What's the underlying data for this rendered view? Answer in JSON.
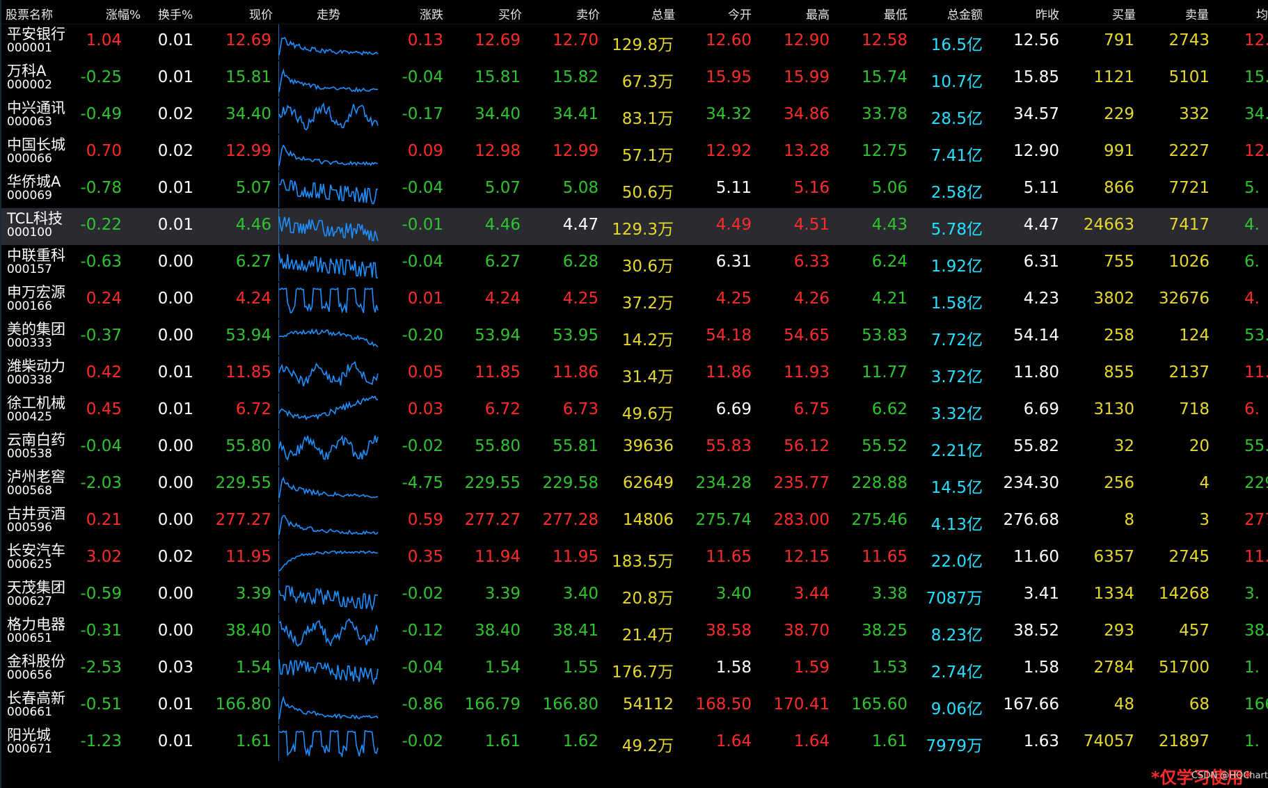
{
  "colors": {
    "up": "#ff2b2b",
    "down": "#2fc42f",
    "flat": "#ffffff",
    "volume": "#e6d82a",
    "amount": "#25e0ff",
    "quantity": "#e6d82a",
    "trend_line": "#1e90ff",
    "selected_row_bg": "#2a2b30"
  },
  "header": {
    "name": "股票名称",
    "change_pct": "涨幅%",
    "turnover": "换手%",
    "price": "现价",
    "trend": "走势",
    "change": "涨跌",
    "bid": "买价",
    "ask": "卖价",
    "volume": "总量",
    "open": "今开",
    "high": "最高",
    "low": "最低",
    "amount": "总金额",
    "prev_close": "昨收",
    "bid_qty": "买量",
    "ask_qty": "卖量",
    "extra_col": "均",
    "extra_value_label": ""
  },
  "rows": [
    {
      "name": "平安银行",
      "code": "000001",
      "change_pct": "1.04",
      "turnover": "0.01",
      "price": "12.69",
      "change": "0.13",
      "bid": "12.69",
      "ask": "12.70",
      "volume": "129.8万",
      "open": "12.60",
      "high": "12.90",
      "low": "12.58",
      "amount": "16.5亿",
      "prev_close": "12.56",
      "bid_qty": "791",
      "ask_qty": "2743",
      "extra": "12.",
      "dir": "up",
      "open_dir": "up",
      "high_dir": "up",
      "low_dir": "up",
      "extra_dir": "up",
      "trend_style": "spike_decay"
    },
    {
      "name": "万科A",
      "code": "000002",
      "change_pct": "-0.25",
      "turnover": "0.01",
      "price": "15.81",
      "change": "-0.04",
      "bid": "15.81",
      "ask": "15.82",
      "volume": "67.3万",
      "open": "15.95",
      "high": "15.99",
      "low": "15.74",
      "amount": "10.7亿",
      "prev_close": "15.85",
      "bid_qty": "1121",
      "ask_qty": "5101",
      "extra": "15.",
      "dir": "down",
      "open_dir": "up",
      "high_dir": "up",
      "low_dir": "down",
      "extra_dir": "down",
      "trend_style": "spike_decay"
    },
    {
      "name": "中兴通讯",
      "code": "000063",
      "change_pct": "-0.49",
      "turnover": "0.02",
      "price": "34.40",
      "change": "-0.17",
      "bid": "34.40",
      "ask": "34.41",
      "volume": "83.1万",
      "open": "34.32",
      "high": "34.86",
      "low": "33.78",
      "amount": "28.5亿",
      "prev_close": "34.57",
      "bid_qty": "229",
      "ask_qty": "332",
      "extra": "34.",
      "dir": "down",
      "open_dir": "down",
      "high_dir": "up",
      "low_dir": "down",
      "extra_dir": "down",
      "trend_style": "wavy"
    },
    {
      "name": "中国长城",
      "code": "000066",
      "change_pct": "0.70",
      "turnover": "0.02",
      "price": "12.99",
      "change": "0.09",
      "bid": "12.98",
      "ask": "12.99",
      "volume": "57.1万",
      "open": "12.92",
      "high": "13.28",
      "low": "12.75",
      "amount": "7.41亿",
      "prev_close": "12.90",
      "bid_qty": "991",
      "ask_qty": "2227",
      "extra": "12.",
      "dir": "up",
      "open_dir": "up",
      "high_dir": "up",
      "low_dir": "down",
      "extra_dir": "up",
      "trend_style": "spike_decay"
    },
    {
      "name": "华侨城A",
      "code": "000069",
      "change_pct": "-0.78",
      "turnover": "0.01",
      "price": "5.07",
      "change": "-0.04",
      "bid": "5.07",
      "ask": "5.08",
      "volume": "50.6万",
      "open": "5.11",
      "high": "5.16",
      "low": "5.06",
      "amount": "2.58亿",
      "prev_close": "5.11",
      "bid_qty": "866",
      "ask_qty": "7721",
      "extra": "5.",
      "dir": "down",
      "open_dir": "flat",
      "high_dir": "up",
      "low_dir": "down",
      "extra_dir": "down",
      "trend_style": "steps"
    },
    {
      "name": "TCL科技",
      "code": "000100",
      "change_pct": "-0.22",
      "turnover": "0.01",
      "price": "4.46",
      "change": "-0.01",
      "bid": "4.46",
      "ask": "4.47",
      "volume": "129.3万",
      "open": "4.49",
      "high": "4.51",
      "low": "4.43",
      "amount": "5.78亿",
      "prev_close": "4.47",
      "bid_qty": "24663",
      "ask_qty": "7417",
      "extra": "4.",
      "dir": "down",
      "ask_dir": "flat",
      "open_dir": "up",
      "high_dir": "up",
      "low_dir": "down",
      "extra_dir": "down",
      "trend_style": "steps",
      "selected": true
    },
    {
      "name": "中联重科",
      "code": "000157",
      "change_pct": "-0.63",
      "turnover": "0.00",
      "price": "6.27",
      "change": "-0.04",
      "bid": "6.27",
      "ask": "6.28",
      "volume": "30.6万",
      "open": "6.31",
      "high": "6.33",
      "low": "6.24",
      "amount": "1.92亿",
      "prev_close": "6.31",
      "bid_qty": "755",
      "ask_qty": "1026",
      "extra": "6.",
      "dir": "down",
      "open_dir": "flat",
      "high_dir": "up",
      "low_dir": "down",
      "extra_dir": "down",
      "trend_style": "steps"
    },
    {
      "name": "申万宏源",
      "code": "000166",
      "change_pct": "0.24",
      "turnover": "0.00",
      "price": "4.24",
      "change": "0.01",
      "bid": "4.24",
      "ask": "4.25",
      "volume": "37.2万",
      "open": "4.25",
      "high": "4.26",
      "low": "4.21",
      "amount": "1.58亿",
      "prev_close": "4.23",
      "bid_qty": "3802",
      "ask_qty": "32676",
      "extra": "4.",
      "dir": "up",
      "open_dir": "up",
      "high_dir": "up",
      "low_dir": "down",
      "extra_dir": "up",
      "trend_style": "block"
    },
    {
      "name": "美的集团",
      "code": "000333",
      "change_pct": "-0.37",
      "turnover": "0.00",
      "price": "53.94",
      "change": "-0.20",
      "bid": "53.94",
      "ask": "53.95",
      "volume": "14.2万",
      "open": "54.18",
      "high": "54.65",
      "low": "53.83",
      "amount": "7.72亿",
      "prev_close": "54.14",
      "bid_qty": "258",
      "ask_qty": "124",
      "extra": "53.",
      "dir": "down",
      "open_dir": "up",
      "high_dir": "up",
      "low_dir": "down",
      "extra_dir": "down",
      "trend_style": "hump_fall"
    },
    {
      "name": "潍柴动力",
      "code": "000338",
      "change_pct": "0.42",
      "turnover": "0.01",
      "price": "11.85",
      "change": "0.05",
      "bid": "11.85",
      "ask": "11.86",
      "volume": "31.4万",
      "open": "11.86",
      "high": "11.93",
      "low": "11.77",
      "amount": "3.72亿",
      "prev_close": "11.80",
      "bid_qty": "855",
      "ask_qty": "2137",
      "extra": "11.",
      "dir": "up",
      "open_dir": "up",
      "high_dir": "up",
      "low_dir": "down",
      "extra_dir": "up",
      "trend_style": "wavy"
    },
    {
      "name": "徐工机械",
      "code": "000425",
      "change_pct": "0.45",
      "turnover": "0.01",
      "price": "6.72",
      "change": "0.03",
      "bid": "6.72",
      "ask": "6.73",
      "volume": "49.6万",
      "open": "6.69",
      "high": "6.75",
      "low": "6.62",
      "amount": "3.32亿",
      "prev_close": "6.69",
      "bid_qty": "3130",
      "ask_qty": "718",
      "extra": "6.",
      "dir": "up",
      "open_dir": "flat",
      "high_dir": "up",
      "low_dir": "down",
      "extra_dir": "up",
      "trend_style": "dip_rise"
    },
    {
      "name": "云南白药",
      "code": "000538",
      "change_pct": "-0.04",
      "turnover": "0.00",
      "price": "55.80",
      "change": "-0.02",
      "bid": "55.80",
      "ask": "55.81",
      "volume": "39636",
      "open": "55.83",
      "high": "56.12",
      "low": "55.52",
      "amount": "2.21亿",
      "prev_close": "55.82",
      "bid_qty": "32",
      "ask_qty": "20",
      "extra": "55.",
      "dir": "down",
      "open_dir": "up",
      "high_dir": "up",
      "low_dir": "down",
      "extra_dir": "down",
      "trend_style": "wavy"
    },
    {
      "name": "泸州老窖",
      "code": "000568",
      "change_pct": "-2.03",
      "turnover": "0.00",
      "price": "229.55",
      "change": "-4.75",
      "bid": "229.55",
      "ask": "229.58",
      "volume": "62649",
      "open": "234.28",
      "high": "235.77",
      "low": "228.88",
      "amount": "14.5亿",
      "prev_close": "234.30",
      "bid_qty": "256",
      "ask_qty": "4",
      "extra": "229.",
      "dir": "down",
      "open_dir": "down",
      "high_dir": "up",
      "low_dir": "down",
      "extra_dir": "down",
      "trend_style": "spike_decay"
    },
    {
      "name": "古井贡酒",
      "code": "000596",
      "change_pct": "0.21",
      "turnover": "0.00",
      "price": "277.27",
      "change": "0.59",
      "bid": "277.27",
      "ask": "277.28",
      "volume": "14806",
      "open": "275.74",
      "high": "283.00",
      "low": "275.46",
      "amount": "4.13亿",
      "prev_close": "276.68",
      "bid_qty": "8",
      "ask_qty": "3",
      "extra": "277.",
      "dir": "up",
      "open_dir": "down",
      "high_dir": "up",
      "low_dir": "down",
      "extra_dir": "up",
      "trend_style": "spike_decay"
    },
    {
      "name": "长安汽车",
      "code": "000625",
      "change_pct": "3.02",
      "turnover": "0.02",
      "price": "11.95",
      "change": "0.35",
      "bid": "11.94",
      "ask": "11.95",
      "volume": "183.5万",
      "open": "11.65",
      "high": "12.15",
      "low": "11.65",
      "amount": "22.0亿",
      "prev_close": "11.60",
      "bid_qty": "6357",
      "ask_qty": "2745",
      "extra": "11.",
      "dir": "up",
      "open_dir": "up",
      "high_dir": "up",
      "low_dir": "up",
      "extra_dir": "up",
      "trend_style": "rise_flat"
    },
    {
      "name": "天茂集团",
      "code": "000627",
      "change_pct": "-0.59",
      "turnover": "0.00",
      "price": "3.39",
      "change": "-0.02",
      "bid": "3.39",
      "ask": "3.40",
      "volume": "20.8万",
      "open": "3.40",
      "high": "3.44",
      "low": "3.38",
      "amount": "7087万",
      "prev_close": "3.41",
      "bid_qty": "1334",
      "ask_qty": "14268",
      "extra": "3.",
      "dir": "down",
      "open_dir": "down",
      "high_dir": "up",
      "low_dir": "down",
      "extra_dir": "down",
      "trend_style": "steps"
    },
    {
      "name": "格力电器",
      "code": "000651",
      "change_pct": "-0.31",
      "turnover": "0.00",
      "price": "38.40",
      "change": "-0.12",
      "bid": "38.40",
      "ask": "38.41",
      "volume": "21.4万",
      "open": "38.58",
      "high": "38.70",
      "low": "38.25",
      "amount": "8.23亿",
      "prev_close": "38.52",
      "bid_qty": "293",
      "ask_qty": "457",
      "extra": "38.",
      "dir": "down",
      "open_dir": "up",
      "high_dir": "up",
      "low_dir": "down",
      "extra_dir": "down",
      "trend_style": "wavy"
    },
    {
      "name": "金科股份",
      "code": "000656",
      "change_pct": "-2.53",
      "turnover": "0.03",
      "price": "1.54",
      "change": "-0.04",
      "bid": "1.54",
      "ask": "1.55",
      "volume": "176.7万",
      "open": "1.58",
      "high": "1.59",
      "low": "1.53",
      "amount": "2.74亿",
      "prev_close": "1.58",
      "bid_qty": "2784",
      "ask_qty": "51700",
      "extra": "1.",
      "dir": "down",
      "open_dir": "flat",
      "high_dir": "up",
      "low_dir": "down",
      "extra_dir": "down",
      "trend_style": "steps"
    },
    {
      "name": "长春高新",
      "code": "000661",
      "change_pct": "-0.51",
      "turnover": "0.01",
      "price": "166.80",
      "change": "-0.86",
      "bid": "166.79",
      "ask": "166.80",
      "volume": "54112",
      "open": "168.50",
      "high": "170.41",
      "low": "165.60",
      "amount": "9.06亿",
      "prev_close": "167.66",
      "bid_qty": "48",
      "ask_qty": "68",
      "extra": "166.",
      "dir": "down",
      "open_dir": "up",
      "high_dir": "up",
      "low_dir": "down",
      "extra_dir": "down",
      "trend_style": "spike_decay"
    },
    {
      "name": "阳光城",
      "code": "000671",
      "change_pct": "-1.23",
      "turnover": "0.01",
      "price": "1.61",
      "change": "-0.02",
      "bid": "1.61",
      "ask": "1.62",
      "volume": "49.2万",
      "open": "1.64",
      "high": "1.64",
      "low": "1.61",
      "amount": "7979万",
      "prev_close": "1.63",
      "bid_qty": "74057",
      "ask_qty": "21897",
      "extra": "1.",
      "dir": "down",
      "open_dir": "up",
      "high_dir": "up",
      "low_dir": "down",
      "extra_dir": "down",
      "trend_style": "block"
    }
  ],
  "watermark": "*仅学习使用*",
  "credit": "CSDN @HQChart"
}
